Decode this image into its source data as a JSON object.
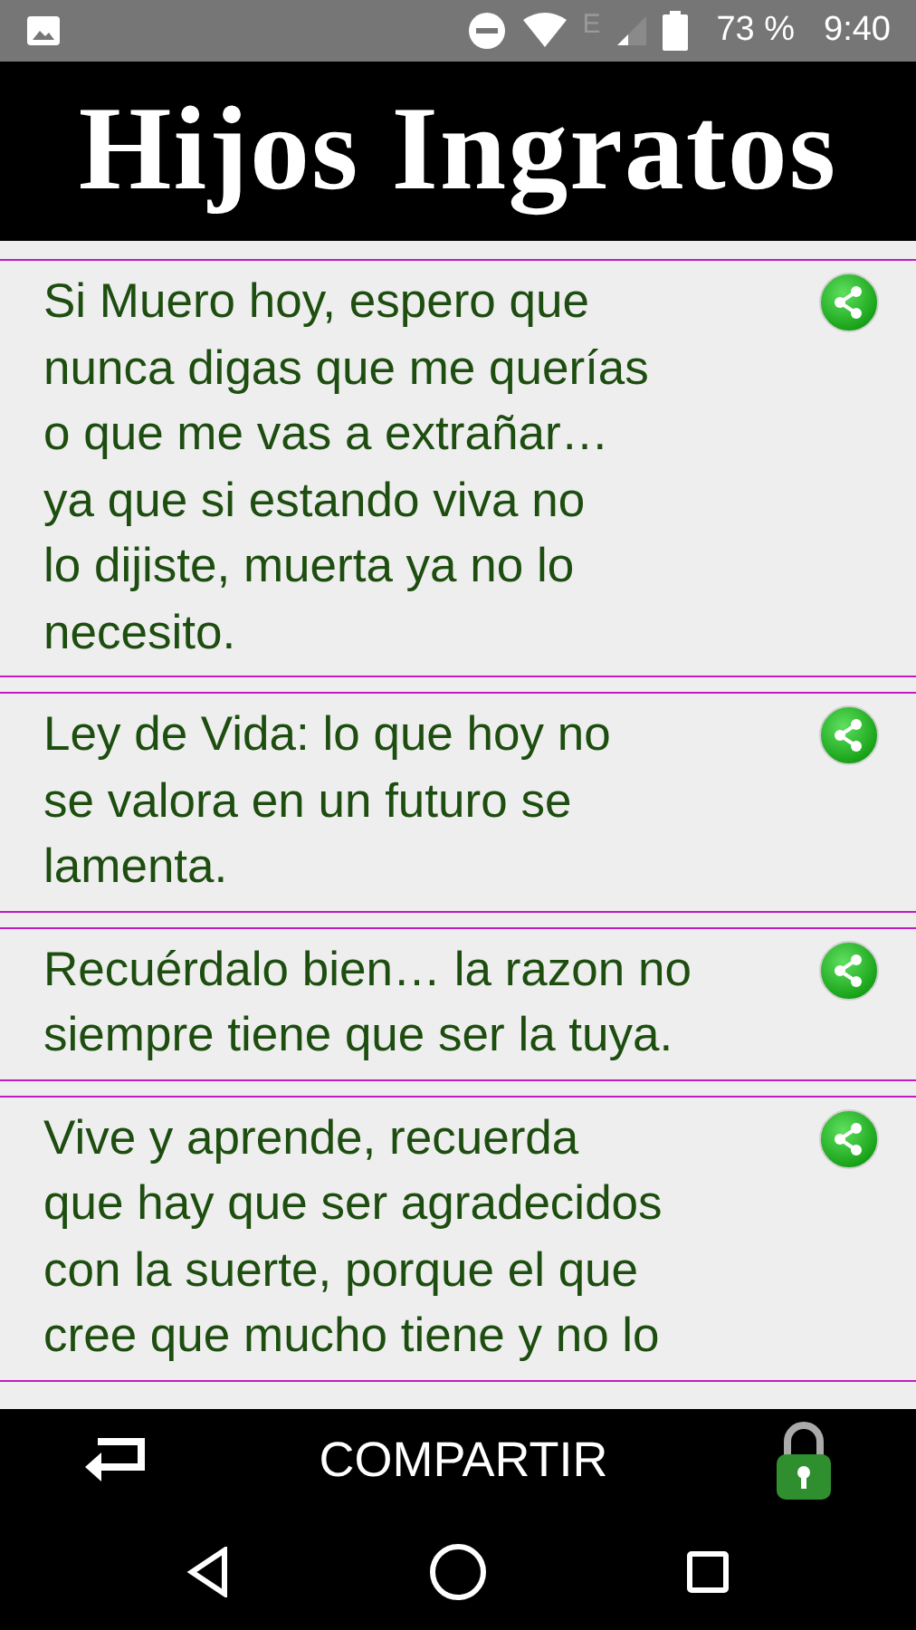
{
  "status_bar": {
    "network_type": "E",
    "battery": "73 %",
    "time": "9:40"
  },
  "header": {
    "title": "Hijos Ingratos"
  },
  "quotes": [
    {
      "text": "Si Muero hoy, espero que\nnunca digas que me querías\no que me vas a extrañar…\nya que si estando viva no\nlo dijiste, muerta ya no lo\nnecesito."
    },
    {
      "text": "Ley de Vida: lo que hoy no\nse valora en un futuro se\nlamenta."
    },
    {
      "text": "Recuérdalo bien… la razon no\nsiempre tiene que ser la tuya."
    },
    {
      "text": "Vive y aprende, recuerda\nque hay que ser agradecidos\ncon la suerte, porque el que\ncree que mucho tiene y no lo"
    }
  ],
  "bottom_bar": {
    "share_label": "COMPARTIR"
  }
}
